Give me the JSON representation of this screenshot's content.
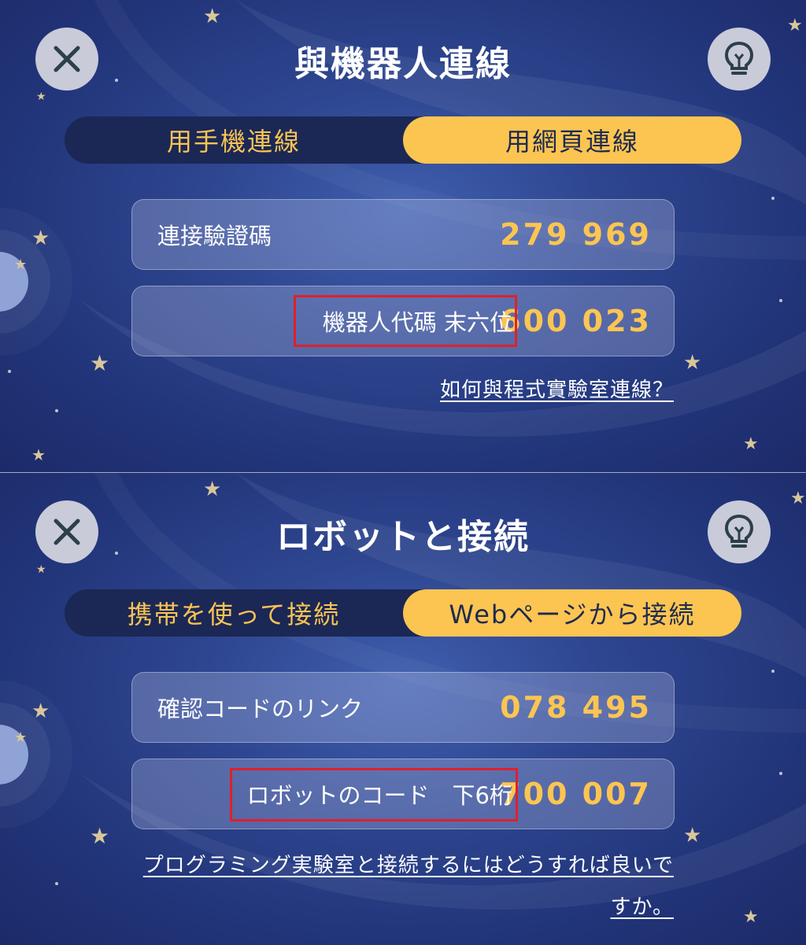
{
  "colors": {
    "accent": "#fcc552",
    "highlight_box": "#e0202a",
    "background": "#22357a"
  },
  "top": {
    "title": "與機器人連線",
    "close_icon": "close-icon",
    "hint_icon": "lightbulb-icon",
    "tabs": [
      {
        "label": "用手機連線",
        "selected": false
      },
      {
        "label": "用網頁連線",
        "selected": true
      }
    ],
    "verify_label": "連接驗證碼",
    "verify_code": "279 969",
    "robot_label": "機器人代碼 末六位",
    "robot_code": "600 023",
    "help_link": "如何與程式實驗室連線？"
  },
  "bottom": {
    "title": "ロボットと接続",
    "close_icon": "close-icon",
    "hint_icon": "lightbulb-icon",
    "tabs": [
      {
        "label": "携帯を使って接続",
        "selected": false
      },
      {
        "label": "Webページから接続",
        "selected": true
      }
    ],
    "verify_label": "確認コードのリンク",
    "verify_code": "078 495",
    "robot_label": "ロボットのコード　下6桁",
    "robot_code": "700 007",
    "help_link": "プログラミング実験室と接続するにはどうすれば良いですか。"
  }
}
